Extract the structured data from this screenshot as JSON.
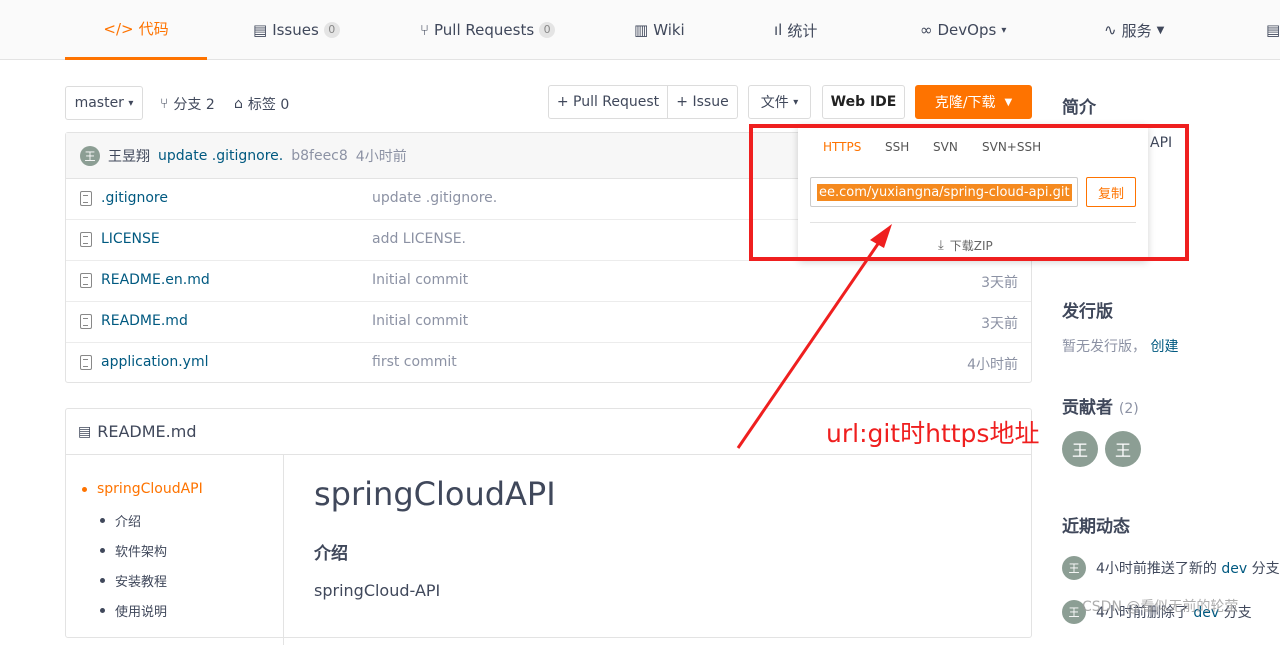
{
  "nav": {
    "code": "代码",
    "issues": "Issues",
    "issues_count": "0",
    "pull_requests": "Pull Requests",
    "pr_count": "0",
    "wiki": "Wiki",
    "stats": "统计",
    "devops": "DevOps",
    "service": "服务"
  },
  "toolbar": {
    "branch": "master",
    "branches": "分支 2",
    "tags": "标签 0",
    "pull_request": "+ Pull Request",
    "issue": "+ Issue",
    "file": "文件",
    "web_ide": "Web IDE",
    "clone": "克隆/下载"
  },
  "commit": {
    "author_initial": "王",
    "author": "王昱翔",
    "message": "update .gitignore.",
    "hash": "b8feec8",
    "time": "4小时前"
  },
  "files": [
    {
      "name": ".gitignore",
      "message": "update .gitignore.",
      "time": ""
    },
    {
      "name": "LICENSE",
      "message": "add LICENSE.",
      "time": ""
    },
    {
      "name": "README.en.md",
      "message": "Initial commit",
      "time": "3天前"
    },
    {
      "name": "README.md",
      "message": "Initial commit",
      "time": "3天前"
    },
    {
      "name": "application.yml",
      "message": "first commit",
      "time": "4小时前"
    }
  ],
  "readme": {
    "file": "README.md",
    "toc": [
      "springCloudAPI",
      "介绍",
      "软件架构",
      "安装教程",
      "使用说明"
    ],
    "title": "springCloudAPI",
    "section": "介绍",
    "body": "springCloud-API"
  },
  "sidebar": {
    "intro": "简介",
    "intro_tail": "API",
    "release": "发行版",
    "release_none": "暂无发行版，",
    "release_create": "创建",
    "contributors": "贡献者",
    "contributors_count": "(2)",
    "contrib_initial": "王",
    "activity": "近期动态",
    "activity_1_prefix": "4小时前推送了新的",
    "activity_1_branch": "dev",
    "activity_1_suffix": "分支",
    "activity_2_prefix": "4小时前删除了",
    "activity_2_branch": "dev",
    "activity_2_suffix": "分支"
  },
  "clone_popup": {
    "tabs": [
      "HTTPS",
      "SSH",
      "SVN",
      "SVN+SSH"
    ],
    "url": "ee.com/yuxiangna/spring-cloud-api.git",
    "copy": "复制",
    "zip": "下载ZIP"
  },
  "annotation": "url:git时https地址",
  "watermark": "CSDN @看似无前的轮萤",
  "colors": {
    "accent": "#fe7300",
    "link": "#005980",
    "annotation": "#ef1f1f"
  }
}
